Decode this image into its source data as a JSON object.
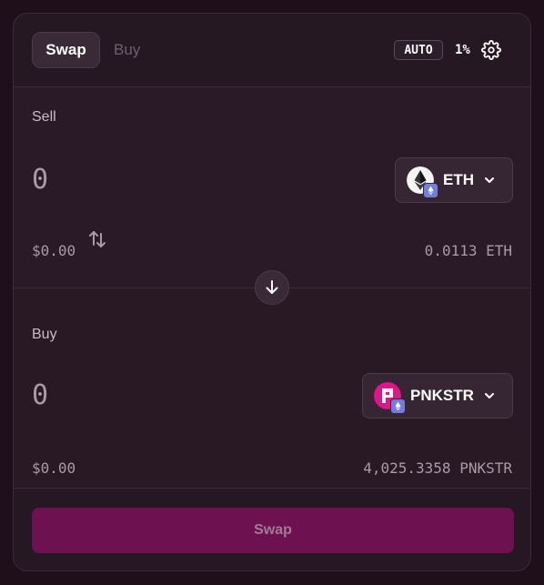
{
  "header": {
    "tabs": [
      {
        "label": "Swap",
        "active": true
      },
      {
        "label": "Buy",
        "active": false
      }
    ],
    "auto_label": "AUTO",
    "slippage": "1%",
    "settings_icon": "gear-icon"
  },
  "sell": {
    "label": "Sell",
    "amount": "0",
    "token": {
      "symbol": "ETH",
      "icon": "ethereum-icon",
      "chain_icon": "ethereum-chain-icon"
    },
    "fiat_value": "$0.00",
    "balance": "0.0113 ETH"
  },
  "flip_icon": "arrow-down-icon",
  "buy": {
    "label": "Buy",
    "amount": "0",
    "token": {
      "symbol": "PNKSTR",
      "icon": "pnkstr-icon",
      "chain_icon": "ethereum-chain-icon"
    },
    "fiat_value": "$0.00",
    "balance": "4,025.3358 PNKSTR"
  },
  "cta": {
    "label": "Swap"
  },
  "colors": {
    "background": "#1e0f1b",
    "card": "#261822",
    "accent": "#6e1151",
    "pnkstr_pink": "#e2148b"
  }
}
